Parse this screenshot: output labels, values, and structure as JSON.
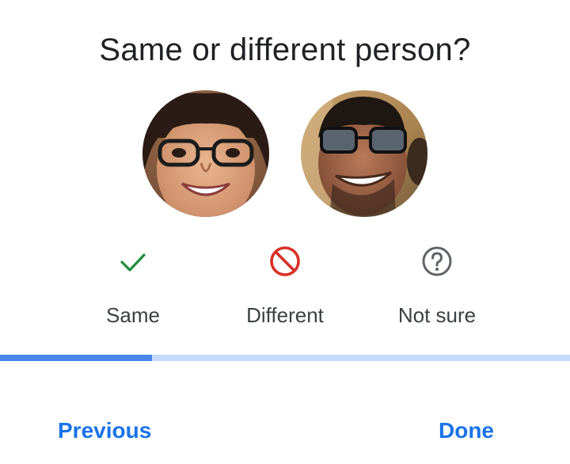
{
  "dialog": {
    "title": "Same or different person?"
  },
  "faces": [
    {
      "name": "face-photo-1"
    },
    {
      "name": "face-photo-2"
    }
  ],
  "options": {
    "same": {
      "label": "Same",
      "icon": "checkmark-icon",
      "color": "#1e8e3e"
    },
    "different": {
      "label": "Different",
      "icon": "no-entry-icon",
      "color": "#d93025"
    },
    "not_sure": {
      "label": "Not sure",
      "icon": "question-circle-icon",
      "color": "#5f6368"
    }
  },
  "progress": {
    "fraction": 0.267,
    "fill_color": "#4a86e8",
    "track_color": "#c6dafc"
  },
  "footer": {
    "previous_label": "Previous",
    "done_label": "Done",
    "link_color": "#1a73e8"
  }
}
